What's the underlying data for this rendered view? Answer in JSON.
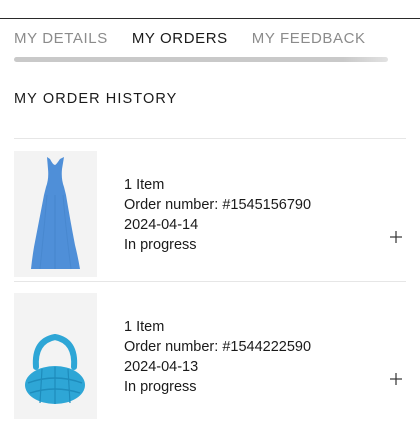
{
  "tabs": [
    {
      "label": "MY DETAILS",
      "active": false
    },
    {
      "label": "MY ORDERS",
      "active": true
    },
    {
      "label": "MY FEEDBACK",
      "active": false
    }
  ],
  "section_title": "MY ORDER HISTORY",
  "orders": [
    {
      "item_count": "1 Item",
      "order_number": "Order number: #1545156790",
      "date": "2024-04-14",
      "status": "In progress",
      "thumbnail": "blue-sleeveless-dress",
      "expand_icon": "plus-icon"
    },
    {
      "item_count": "1 Item",
      "order_number": "Order number: #1544222590",
      "date": "2024-04-13",
      "status": "In progress",
      "thumbnail": "blue-quilted-bag",
      "expand_icon": "plus-icon"
    }
  ],
  "colors": {
    "active_tab": "#1a1a1a",
    "inactive_tab": "#8b8b8b",
    "dress": "#4f8fd8",
    "bag": "#2ea6d6"
  }
}
